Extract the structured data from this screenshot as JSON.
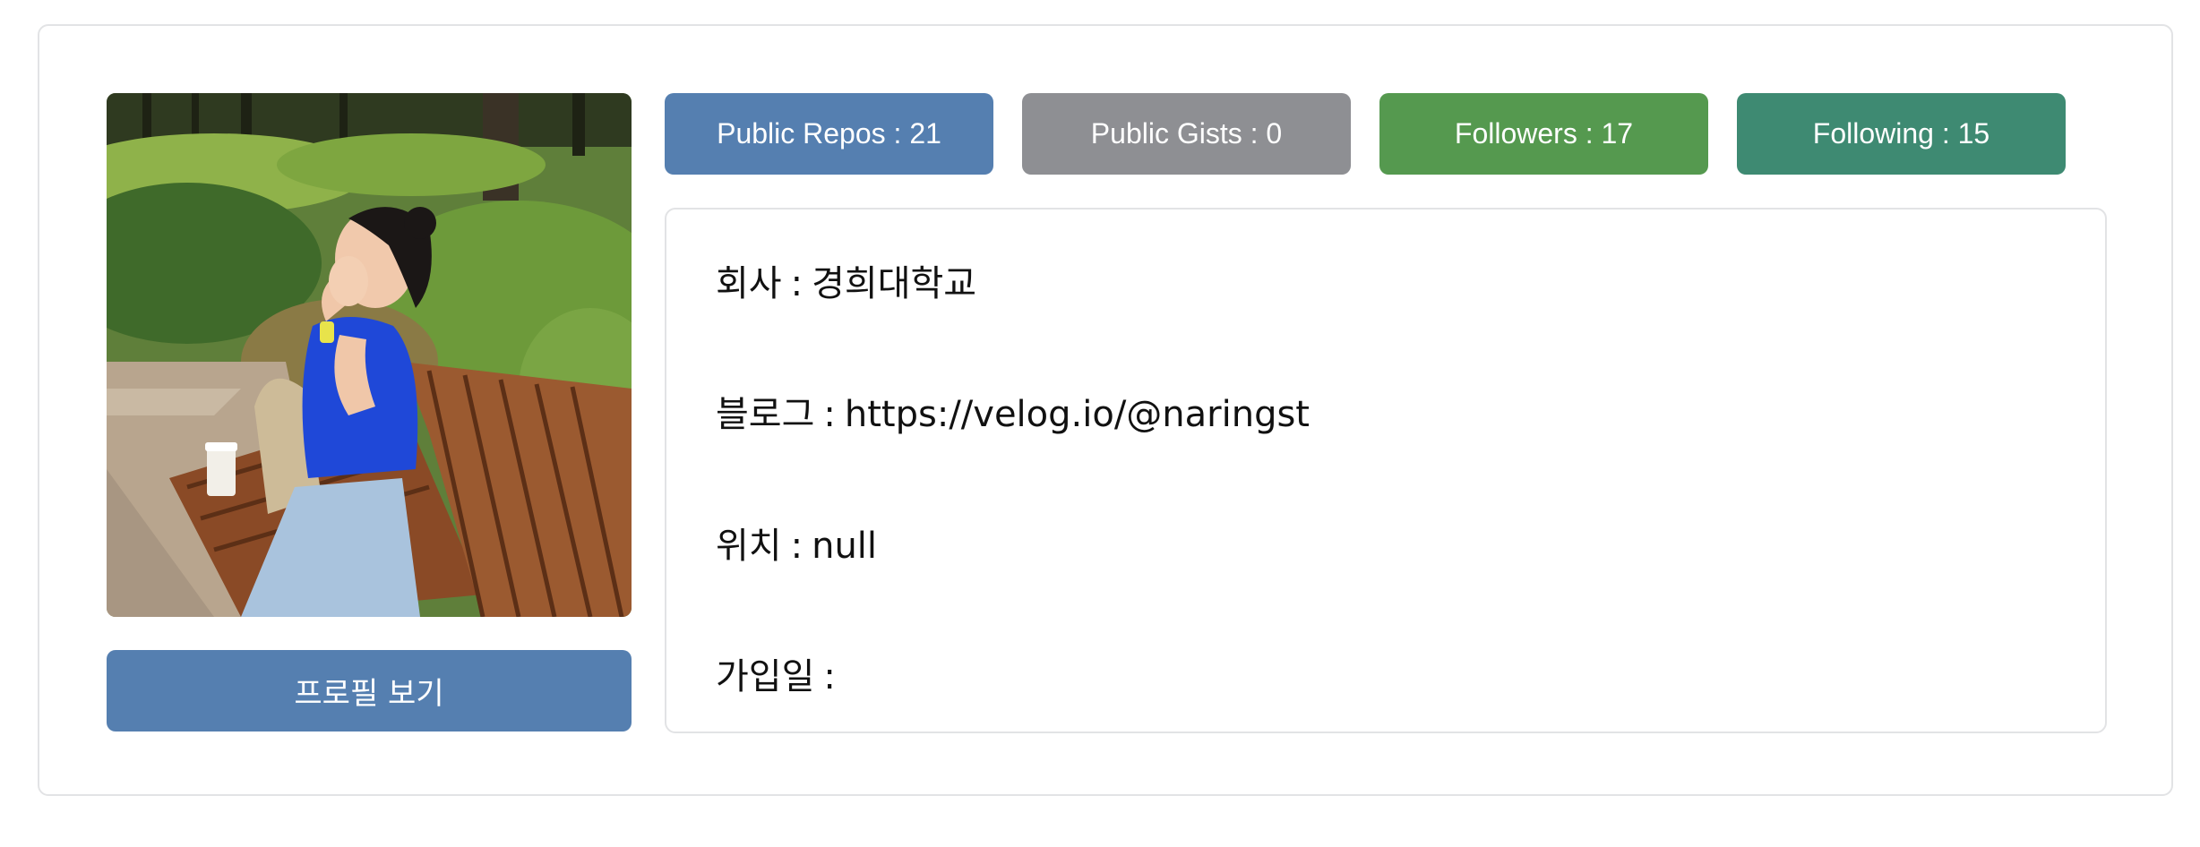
{
  "colors": {
    "repos": "#557fb0",
    "gists": "#8e8f93",
    "followers": "#55994f",
    "following": "#3e8a72",
    "profile_button": "#557fb0",
    "border": "#e2e3e5"
  },
  "avatar": {
    "icon": "profile-photo"
  },
  "profile_button": {
    "label": "프로필 보기"
  },
  "badges": {
    "repos": "Public Repos : 21",
    "gists": "Public Gists : 0",
    "followers": "Followers : 17",
    "following": "Following : 15"
  },
  "info": {
    "company_label": "회사",
    "company_value": "경희대학교",
    "blog_label": "블로그",
    "blog_value": "https://velog.io/@naringst",
    "location_label": "위치",
    "location_value": "null",
    "joined_label": "가입일",
    "joined_value": "",
    "separator": ":"
  }
}
